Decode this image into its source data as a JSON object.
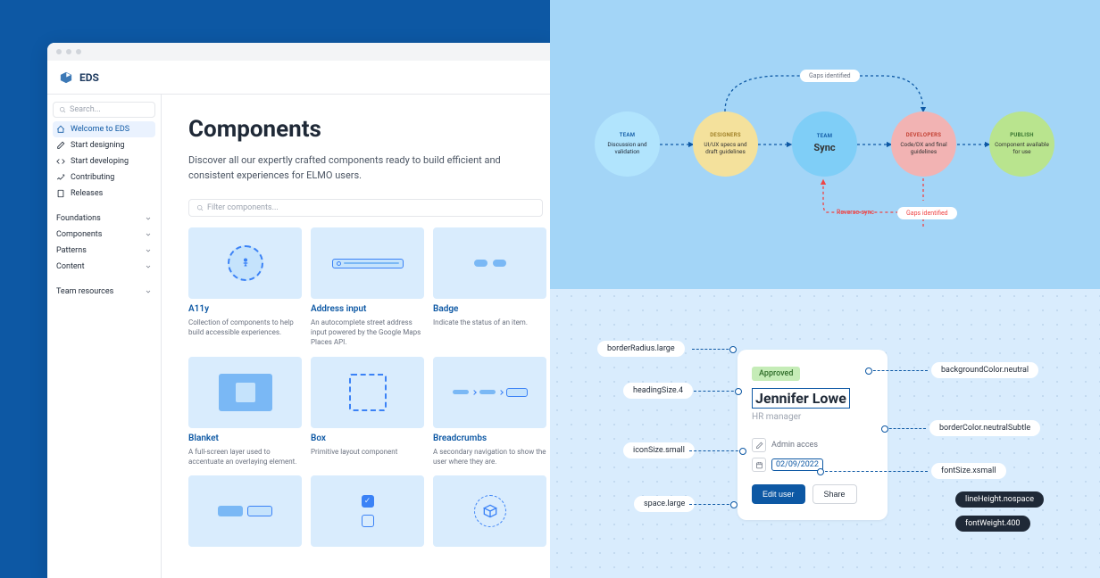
{
  "app": {
    "name": "EDS"
  },
  "sidebar": {
    "search_placeholder": "Search...",
    "nav": [
      {
        "label": "Welcome to EDS",
        "icon": "home"
      },
      {
        "label": "Start designing",
        "icon": "pen"
      },
      {
        "label": "Start developing",
        "icon": "code"
      },
      {
        "label": "Contributing",
        "icon": "chart"
      },
      {
        "label": "Releases",
        "icon": "file"
      }
    ],
    "sections": [
      {
        "label": "Foundations"
      },
      {
        "label": "Components"
      },
      {
        "label": "Patterns"
      },
      {
        "label": "Content"
      }
    ],
    "footer": {
      "label": "Team resources"
    }
  },
  "main": {
    "title": "Components",
    "subtitle": "Discover all our expertly crafted components ready to build efficient and consistent experiences for ELMO users.",
    "filter_placeholder": "Filter components...",
    "components": [
      {
        "title": "A11y",
        "desc": "Collection of components to help build accessible experiences."
      },
      {
        "title": "Address input",
        "desc": "An autocomplete street address input powered by the Google Maps Places API."
      },
      {
        "title": "Badge",
        "desc": "Indicate the status of an item."
      },
      {
        "title": "Blanket",
        "desc": "A full-screen layer used to accentuate an overlaying element."
      },
      {
        "title": "Box",
        "desc": "Primitive layout component"
      },
      {
        "title": "Breadcrumbs",
        "desc": "A secondary navigation to show the user where they are."
      }
    ]
  },
  "diagram": {
    "nodes": {
      "team": {
        "label": "TEAM",
        "text": "Discussion and validation"
      },
      "designers": {
        "label": "DESIGNERS",
        "text": "UI/UX specs and draft guidelines"
      },
      "sync": {
        "label": "TEAM",
        "text": "Sync"
      },
      "developers": {
        "label": "DEVELOPERS",
        "text": "Code/DX and final guidelines"
      },
      "publish": {
        "label": "PUBLISH",
        "text": "Component available for use"
      }
    },
    "pills": {
      "gaps1": "Gaps identified",
      "gaps2": "Gaps identified",
      "reverse": "Reverse-sync"
    }
  },
  "tokens": {
    "card": {
      "badge": "Approved",
      "name": "Jennifer Lowe",
      "role": "HR manager",
      "access": "Admin acces",
      "date": "02/09/2022",
      "primary_btn": "Edit user",
      "secondary_btn": "Share"
    },
    "labels": {
      "borderRadius": "borderRadius.large",
      "bgNeutral": "backgroundColor.neutral",
      "headingSize": "headingSize.4",
      "borderColor": "borderColor.neutralSubtle",
      "iconSize": "iconSize.small",
      "fontSize": "fontSize.xsmall",
      "spaceLarge": "space.large",
      "lineHeight": "lineHeight.nospace",
      "fontWeight": "fontWeight.400"
    }
  }
}
